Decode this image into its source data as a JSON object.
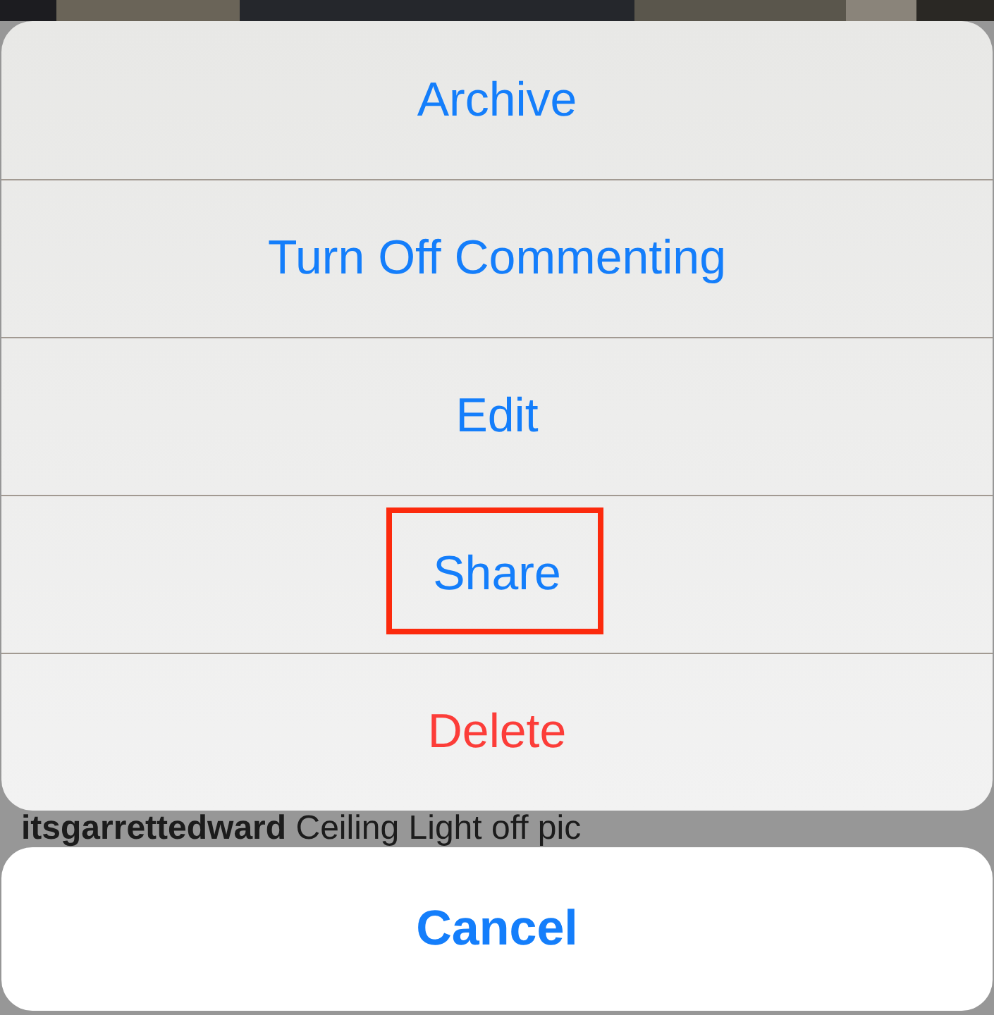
{
  "action_sheet": {
    "actions": [
      {
        "label": "Archive",
        "kind": "default",
        "highlighted": false
      },
      {
        "label": "Turn Off Commenting",
        "kind": "default",
        "highlighted": false
      },
      {
        "label": "Edit",
        "kind": "default",
        "highlighted": false
      },
      {
        "label": "Share",
        "kind": "default",
        "highlighted": true
      },
      {
        "label": "Delete",
        "kind": "destructive",
        "highlighted": false
      }
    ]
  },
  "background_post": {
    "kind": "picture",
    "caption": {
      "username": "itsgarrettedward",
      "text": "Ceiling Light off pic"
    }
  },
  "cancel_button": {
    "label": "Cancel"
  }
}
